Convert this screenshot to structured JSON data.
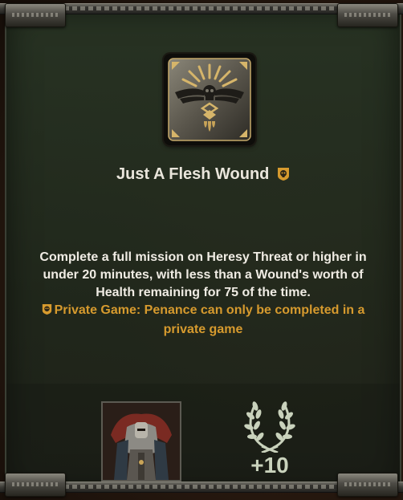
{
  "penance": {
    "title": "Just A Flesh Wound",
    "icon": "winged-skull-blood-emblem-icon",
    "badge_icon": "private-game-skull-icon",
    "description": "Complete a full mission on Heresy Threat or higher in under 20 minutes, with less than a Wound's worth of Health remaining for 75 of the time.",
    "private_note": "Private Game: Penance can only be completed in a private game"
  },
  "reward": {
    "item_icon": "armored-character-portrait",
    "points_icon": "laurel-wreath-icon",
    "points": "+10"
  },
  "colors": {
    "accent": "#d69a2e",
    "text": "#f0ece4",
    "panel": "#28342a"
  }
}
